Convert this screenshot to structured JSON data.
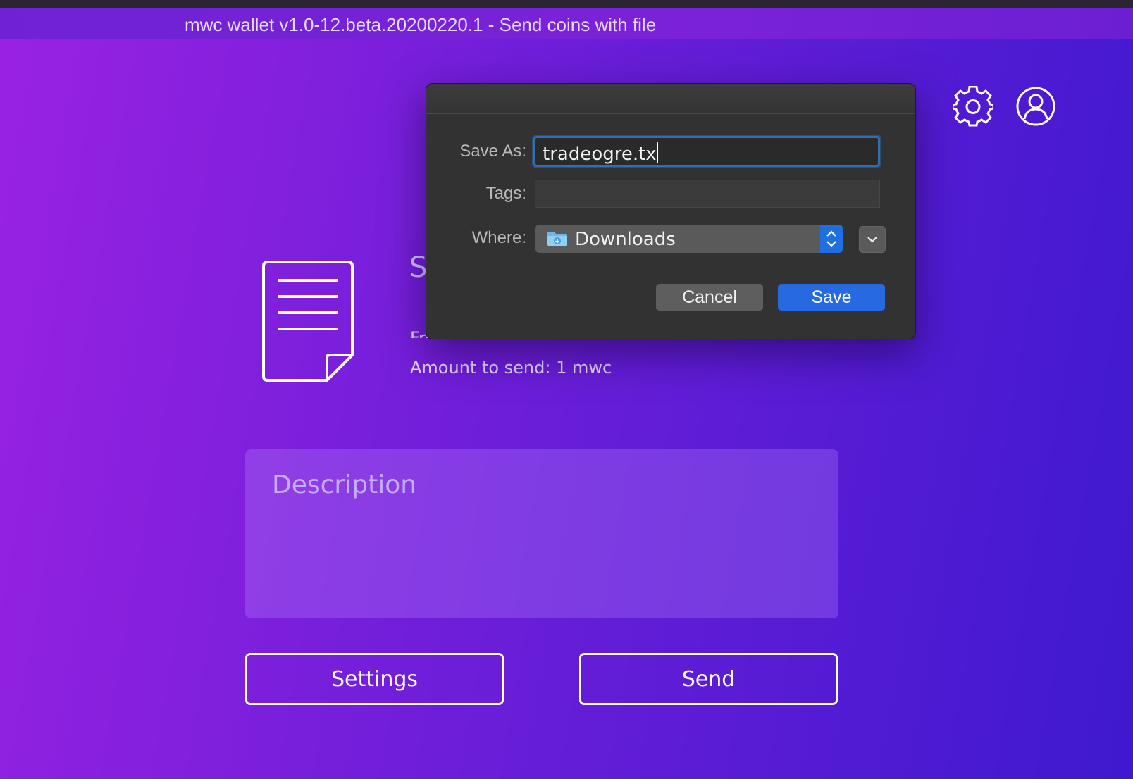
{
  "window": {
    "title": "mwc wallet v1.0-12.beta.20200220.1 - Send coins with file"
  },
  "header_icons": [
    "refresh-icon",
    "gear-icon",
    "account-icon"
  ],
  "main": {
    "heading_partial": "S",
    "from_account_partial": "From account: default",
    "amount_to_send": "Amount to send: 1 mwc",
    "description_placeholder": "Description",
    "settings_button": "Settings",
    "send_button": "Send"
  },
  "save_dialog": {
    "save_as_label": "Save As:",
    "save_as_value": "tradeogre.tx",
    "tags_label": "Tags:",
    "tags_value": "",
    "where_label": "Where:",
    "where_value": "Downloads",
    "cancel_label": "Cancel",
    "save_label": "Save"
  },
  "colors": {
    "background_start": "#9a22e2",
    "background_end": "#3e19cf",
    "dialog_bg": "#323232",
    "primary_button": "#2669e0"
  }
}
